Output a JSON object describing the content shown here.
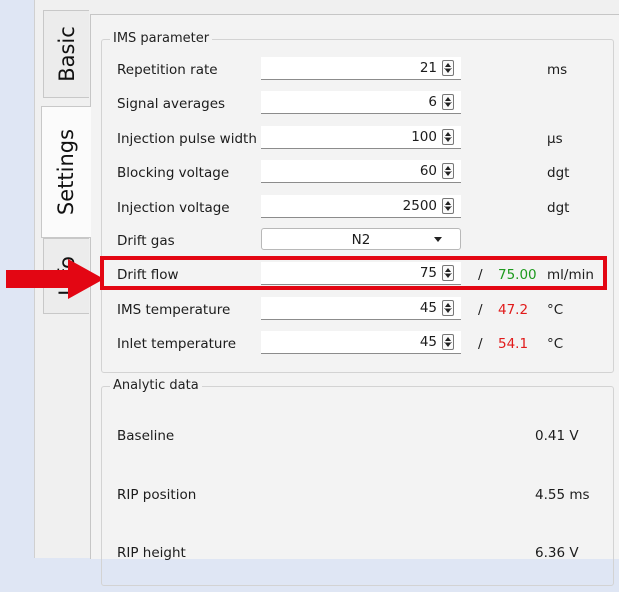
{
  "tabs": [
    {
      "label": "Basic",
      "active": false
    },
    {
      "label": "Settings",
      "active": true
    },
    {
      "label": "Info",
      "active": false
    }
  ],
  "ims_group": {
    "title": "IMS parameter",
    "rows": [
      {
        "label": "Repetition rate",
        "value": "21",
        "actual": "",
        "unit": "ms"
      },
      {
        "label": "Signal averages",
        "value": "6",
        "actual": "",
        "unit": ""
      },
      {
        "label": "Injection pulse width",
        "value": "100",
        "actual": "",
        "unit": "µs"
      },
      {
        "label": "Blocking voltage",
        "value": "60",
        "actual": "",
        "unit": "dgt"
      },
      {
        "label": "Injection voltage",
        "value": "2500",
        "actual": "",
        "unit": "dgt"
      },
      {
        "label": "Drift gas",
        "value": "N2",
        "actual": "",
        "unit": ""
      },
      {
        "label": "Drift flow",
        "value": "75",
        "slash": "/",
        "actual": "75.00",
        "actual_color": "#1e9a1e",
        "unit": "ml/min"
      },
      {
        "label": "IMS temperature",
        "value": "45",
        "slash": "/",
        "actual": "47.2",
        "actual_color": "#e11a1a",
        "unit": "°C"
      },
      {
        "label": "Inlet temperature",
        "value": "45",
        "slash": "/",
        "actual": "54.1",
        "actual_color": "#e11a1a",
        "unit": "°C"
      }
    ]
  },
  "analytic_group": {
    "title": "Analytic data",
    "rows": [
      {
        "label": "Baseline",
        "value": "0.41  V"
      },
      {
        "label": "RIP position",
        "value": "4.55  ms"
      },
      {
        "label": "RIP height",
        "value": "6.36  V"
      }
    ]
  },
  "annotation": {
    "color": "#e30613"
  }
}
